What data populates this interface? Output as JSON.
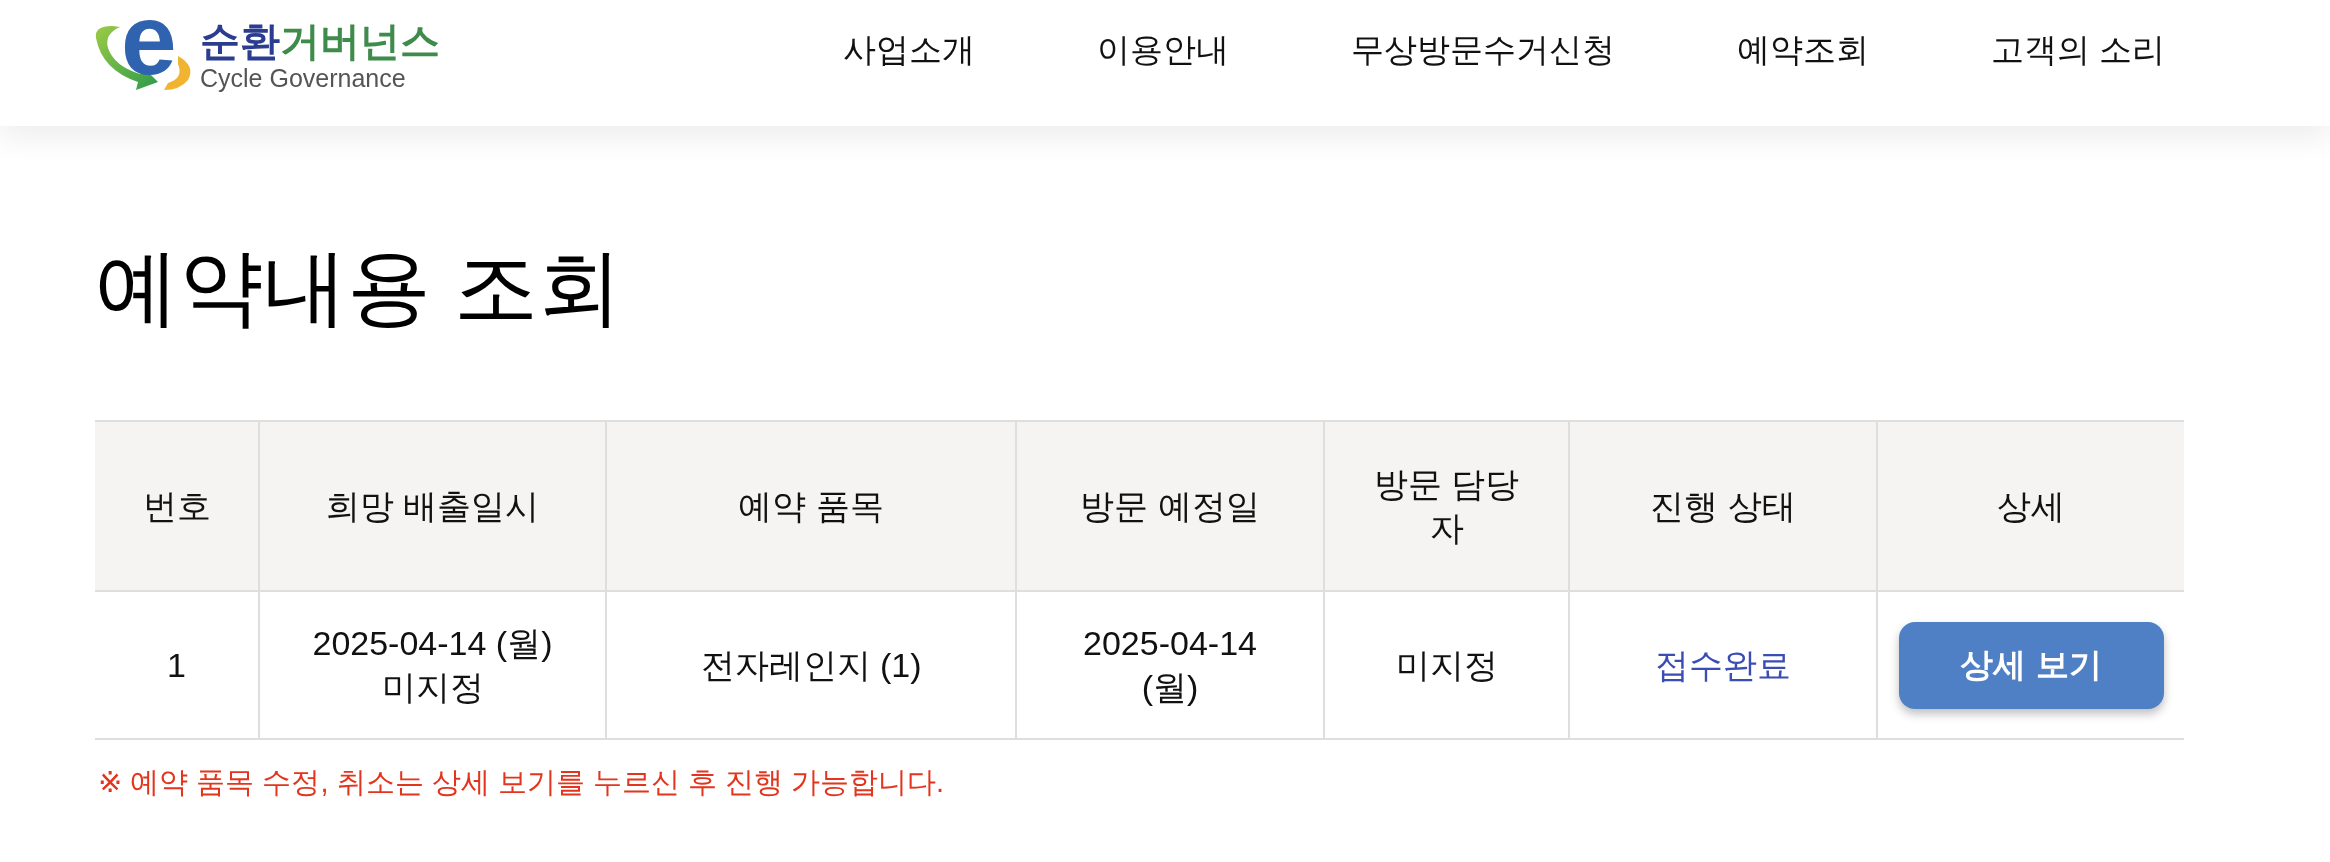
{
  "logo": {
    "mark": "e",
    "title_parts": [
      {
        "text": "순환",
        "color": "#2b3d8f"
      },
      {
        "text": "거버넌스",
        "color": "#3f8b4c"
      }
    ],
    "subtitle": "Cycle Governance"
  },
  "nav": {
    "items": [
      {
        "label": "사업소개"
      },
      {
        "label": "이용안내"
      },
      {
        "label": "무상방문수거신청"
      },
      {
        "label": "예약조회"
      },
      {
        "label": "고객의 소리"
      }
    ]
  },
  "page_title": "예약내용 조회",
  "table": {
    "columns": [
      "번호",
      "희망 배출일시",
      "예약 품목",
      "방문 예정일",
      "방문 담당자",
      "진행 상태",
      "상세"
    ],
    "rows": [
      {
        "number": "1",
        "desired_disposal": "2025-04-14 (월) 미지정",
        "item": "전자레인지 (1)",
        "visit_date": "2025-04-14 (월)",
        "manager": "미지정",
        "status": "접수완료",
        "detail_button": "상세 보기"
      }
    ]
  },
  "note": "※ 예약 품목 수정, 취소는 상세 보기를 누르신 후 진행 가능합니다."
}
